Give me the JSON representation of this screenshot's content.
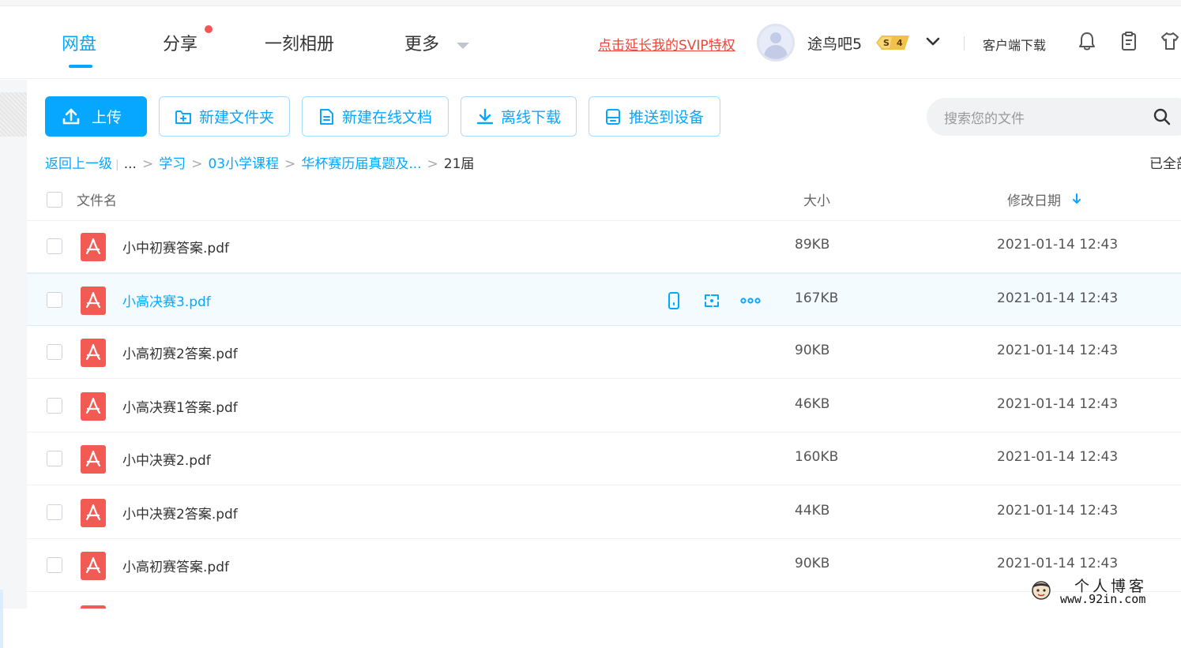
{
  "nav": {
    "items": [
      {
        "label": "网盘"
      },
      {
        "label": "分享"
      },
      {
        "label": "一刻相册"
      },
      {
        "label": "更多"
      }
    ]
  },
  "header": {
    "svip_link": "点击延长我的SVIP特权",
    "username": "途鸟吧5",
    "badge_letter": "S",
    "badge_level": "4",
    "client_download": "客户端下载"
  },
  "toolbar": {
    "upload": "上传",
    "new_folder": "新建文件夹",
    "new_doc": "新建在线文档",
    "offline_download": "离线下载",
    "push_device": "推送到设备"
  },
  "search": {
    "placeholder": "搜索您的文件"
  },
  "breadcrumb": {
    "back": "返回上一级",
    "ellipsis": "...",
    "items": [
      "学习",
      "03小学课程",
      "华杯赛历届真题及..."
    ],
    "current": "21届"
  },
  "selected_all": "已全部",
  "table": {
    "headers": {
      "name": "文件名",
      "size": "大小",
      "date": "修改日期"
    },
    "rows": [
      {
        "name": "小中初赛答案.pdf",
        "size": "89KB",
        "date": "2021-01-14 12:43"
      },
      {
        "name": "小高决赛3.pdf",
        "size": "167KB",
        "date": "2021-01-14 12:43"
      },
      {
        "name": "小高初赛2答案.pdf",
        "size": "90KB",
        "date": "2021-01-14 12:43"
      },
      {
        "name": "小高决赛1答案.pdf",
        "size": "46KB",
        "date": "2021-01-14 12:43"
      },
      {
        "name": "小中决赛2.pdf",
        "size": "160KB",
        "date": "2021-01-14 12:43"
      },
      {
        "name": "小中决赛2答案.pdf",
        "size": "44KB",
        "date": "2021-01-14 12:43"
      },
      {
        "name": "小高初赛答案.pdf",
        "size": "90KB",
        "date": "2021-01-14 12:43"
      }
    ]
  },
  "watermark": {
    "title": "个人博客",
    "url": "www.92in.com"
  },
  "colors": {
    "accent": "#06a7ff",
    "svip_red": "#e8483a",
    "pdf_red": "#f25b54",
    "badge_gold": "#f0c24a"
  },
  "icons": [
    "upload-icon",
    "folder-plus-icon",
    "document-icon",
    "download-icon",
    "device-icon",
    "search-icon",
    "bell-icon",
    "clipboard-icon",
    "shirt-icon",
    "chevron-down-icon",
    "pdf-icon",
    "phone-icon",
    "share-transfer-icon",
    "more-dots-icon",
    "sort-down-arrow-icon"
  ]
}
